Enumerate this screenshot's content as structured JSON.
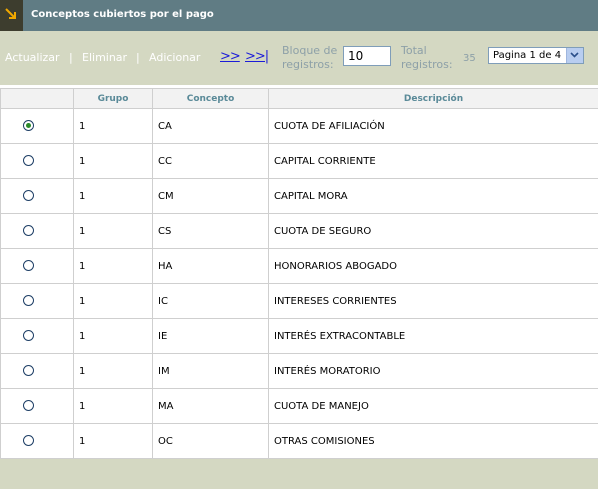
{
  "header": {
    "title": "Conceptos cubiertos por el pago"
  },
  "toolbar": {
    "update_label": "Actualizar",
    "delete_label": "Eliminar",
    "add_label": "Adicionar",
    "separator": "|",
    "next_label": ">>",
    "last_label": ">>|",
    "block_label_1": "Bloque de",
    "block_label_2": "registros:",
    "block_value": "10",
    "total_label_1": "Total",
    "total_label_2": "registros:",
    "total_value": "35",
    "page_select": "Pagina 1 de 4"
  },
  "table": {
    "headers": [
      "",
      "Grupo",
      "Concepto",
      "Descripción"
    ],
    "rows": [
      {
        "selected": true,
        "grupo": "1",
        "concepto": "CA",
        "descripcion": "CUOTA DE AFILIACIÓN"
      },
      {
        "selected": false,
        "grupo": "1",
        "concepto": "CC",
        "descripcion": "CAPITAL CORRIENTE"
      },
      {
        "selected": false,
        "grupo": "1",
        "concepto": "CM",
        "descripcion": "CAPITAL MORA"
      },
      {
        "selected": false,
        "grupo": "1",
        "concepto": "CS",
        "descripcion": "CUOTA DE SEGURO"
      },
      {
        "selected": false,
        "grupo": "1",
        "concepto": "HA",
        "descripcion": "HONORARIOS ABOGADO"
      },
      {
        "selected": false,
        "grupo": "1",
        "concepto": "IC",
        "descripcion": "INTERESES CORRIENTES"
      },
      {
        "selected": false,
        "grupo": "1",
        "concepto": "IE",
        "descripcion": "INTERÉS EXTRACONTABLE"
      },
      {
        "selected": false,
        "grupo": "1",
        "concepto": "IM",
        "descripcion": "INTERÉS MORATORIO"
      },
      {
        "selected": false,
        "grupo": "1",
        "concepto": "MA",
        "descripcion": "CUOTA DE MANEJO"
      },
      {
        "selected": false,
        "grupo": "1",
        "concepto": "OC",
        "descripcion": "OTRAS COMISIONES"
      }
    ]
  },
  "colors": {
    "titlebar": "#607c84",
    "toolbar": "#d4d8c2",
    "header_text": "#5a8a98",
    "link": "#1c1cd8"
  },
  "icons": {
    "title": "arrow-down-right-icon",
    "select": "chevron-down-icon",
    "radio": "radio-icon"
  }
}
